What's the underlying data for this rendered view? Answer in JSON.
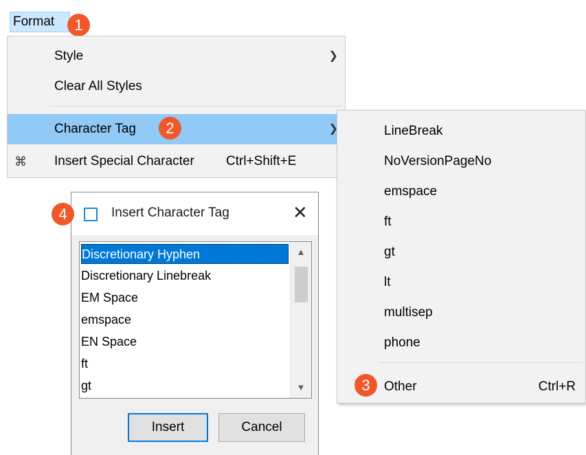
{
  "menubar": {
    "format_label": "Format"
  },
  "badges": {
    "b1": "1",
    "b2": "2",
    "b3": "3",
    "b4": "4"
  },
  "format_menu": {
    "items": [
      {
        "label": "Style",
        "has_submenu": true
      },
      {
        "label": "Clear All Styles"
      },
      {
        "label": "Character Tag",
        "has_submenu": true,
        "highlighted": true
      },
      {
        "label": "Insert Special Character",
        "shortcut": "Ctrl+Shift+E",
        "icon": "special-character-icon"
      }
    ]
  },
  "submenu": {
    "items": [
      "LineBreak",
      "NoVersionPageNo",
      "emspace",
      "ft",
      "gt",
      "lt",
      "multisep",
      "phone"
    ],
    "other_label": "Other",
    "other_shortcut": "Ctrl+R"
  },
  "dialog": {
    "title": "Insert Character Tag",
    "close_glyph": "✕",
    "list_items": [
      "Discretionary Hyphen",
      "Discretionary Linebreak",
      "EM Space",
      "emspace",
      "EN Space",
      "ft",
      "gt"
    ],
    "selected_index": 0,
    "insert_label": "Insert",
    "cancel_label": "Cancel"
  },
  "colors": {
    "badge": "#f0582a",
    "highlight": "#91c9f7",
    "selection": "#0078d7",
    "menubar_active": "#cce8ff"
  }
}
